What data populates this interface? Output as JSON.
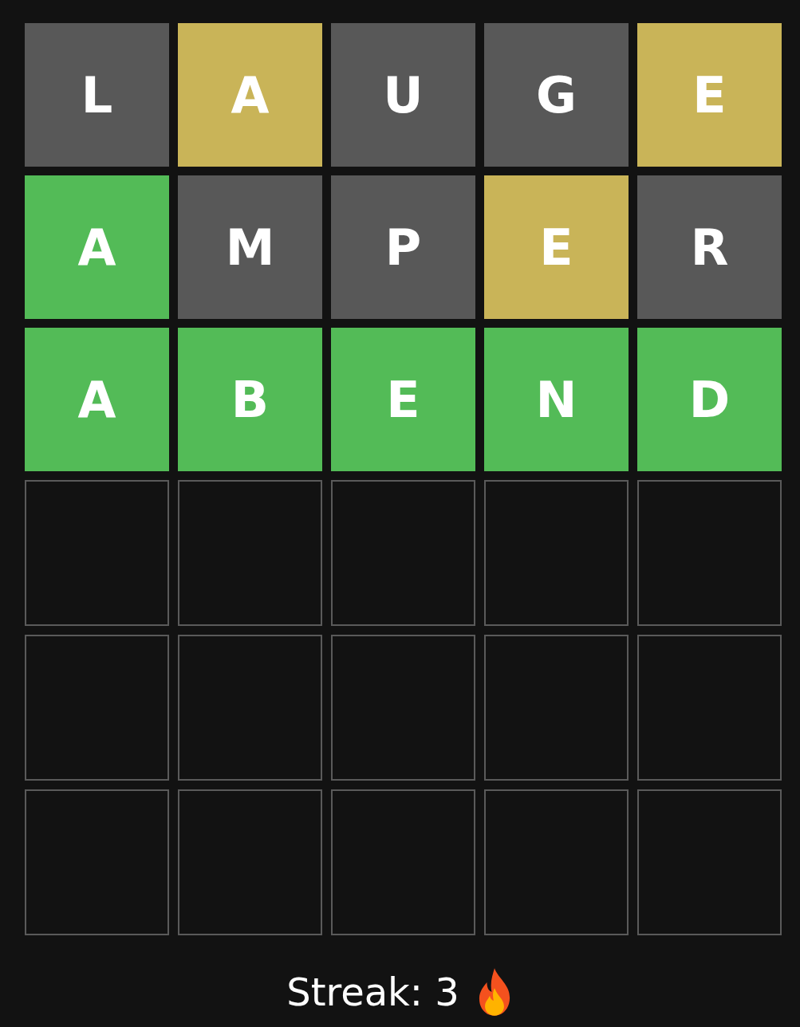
{
  "board": {
    "rows": [
      {
        "tiles": [
          {
            "letter": "L",
            "kind": "absent"
          },
          {
            "letter": "A",
            "kind": "present"
          },
          {
            "letter": "U",
            "kind": "absent"
          },
          {
            "letter": "G",
            "kind": "absent"
          },
          {
            "letter": "E",
            "kind": "present"
          }
        ]
      },
      {
        "tiles": [
          {
            "letter": "A",
            "kind": "correct"
          },
          {
            "letter": "M",
            "kind": "absent"
          },
          {
            "letter": "P",
            "kind": "absent"
          },
          {
            "letter": "E",
            "kind": "present"
          },
          {
            "letter": "R",
            "kind": "absent"
          }
        ]
      },
      {
        "tiles": [
          {
            "letter": "A",
            "kind": "correct"
          },
          {
            "letter": "B",
            "kind": "correct"
          },
          {
            "letter": "E",
            "kind": "correct"
          },
          {
            "letter": "N",
            "kind": "correct"
          },
          {
            "letter": "D",
            "kind": "correct"
          }
        ]
      },
      {
        "tiles": [
          {
            "kind": "empty"
          },
          {
            "kind": "empty"
          },
          {
            "kind": "empty"
          },
          {
            "kind": "empty"
          },
          {
            "kind": "empty"
          }
        ]
      },
      {
        "tiles": [
          {
            "kind": "empty"
          },
          {
            "kind": "empty"
          },
          {
            "kind": "empty"
          },
          {
            "kind": "empty"
          },
          {
            "kind": "empty"
          }
        ]
      },
      {
        "tiles": [
          {
            "kind": "empty"
          },
          {
            "kind": "empty"
          },
          {
            "kind": "empty"
          },
          {
            "kind": "empty"
          },
          {
            "kind": "empty"
          }
        ]
      }
    ]
  },
  "streak": {
    "label": "Streak: 3"
  }
}
